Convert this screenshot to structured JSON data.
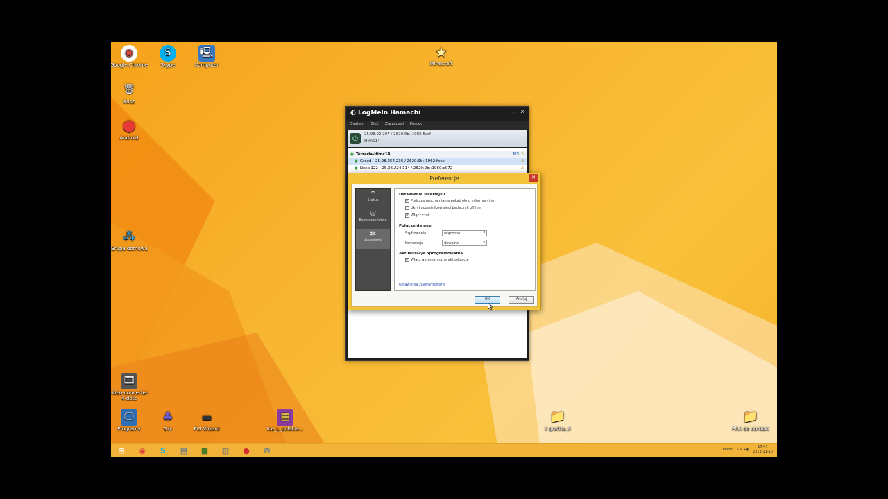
{
  "desktop": {
    "icons": [
      {
        "label": "Google Chrome",
        "glyph": "◉",
        "color": "#db4437"
      },
      {
        "label": "Skype",
        "glyph": "S",
        "color": "#00aff0"
      },
      {
        "label": "Komputer",
        "glyph": "🖳",
        "color": "#3a78c2"
      },
      {
        "label": "Minecraft",
        "glyph": "★",
        "color": "#f6e06a"
      },
      {
        "label": "Kosz",
        "glyph": "🗑",
        "color": "#aaa"
      },
      {
        "label": "Android",
        "glyph": "●",
        "color": "#e53935"
      },
      {
        "label": "Grupa domowa",
        "glyph": "⁂",
        "color": "#3aa0e0"
      },
      {
        "label": "video-converter-4-dots",
        "glyph": "🎞",
        "color": "#555"
      },
      {
        "label": "Programy",
        "glyph": "🖵",
        "color": "#2f6fb8"
      },
      {
        "label": "Gry",
        "glyph": "♣",
        "color": "#6a5acd"
      },
      {
        "label": "PCI Wizard",
        "glyph": "▬",
        "color": "#444"
      },
      {
        "label": "Ice_L_polskie...",
        "glyph": "▦",
        "color": "#8b3aa0"
      },
      {
        "label": "ll grafika_ll",
        "glyph": "📁",
        "color": "#e3c36a"
      },
      {
        "label": "Pliki do obróbki",
        "glyph": "📁",
        "color": "#e3c36a"
      }
    ]
  },
  "hamachi": {
    "title": "LogMeIn Hamachi",
    "menu": [
      "System",
      "Sieć",
      "Zarządzaj",
      "Pomoc"
    ],
    "address": "25.98.92.207 / 2620:9b::1982:5ccf",
    "client_name": "Himc14",
    "network": {
      "name": "Terraria-Himc14",
      "count": "3/3"
    },
    "peers": [
      "Greed - 25.98.254.236 / 2620:9b::1962:feec",
      "Nexio122 - 25.96.224.114 / 2620:9b::1960:e072"
    ]
  },
  "preferences": {
    "title": "Preferencje",
    "sidebar": [
      "Status",
      "Bezpieczeństwo",
      "Ustawienia"
    ],
    "interface_header": "Ustawienia interfejsu",
    "checkboxes": [
      {
        "label": "Podczas uruchamiania pokaż okno informacyjne",
        "checked": "✔"
      },
      {
        "label": "Ukryj uczestników sieci będących offline",
        "checked": ""
      },
      {
        "label": "Włącz czat",
        "checked": "✔"
      }
    ],
    "peer_header": "Połączenia peer",
    "encryption_label": "Szyfrowanie",
    "encryption_value": "włączono",
    "compression_label": "Kompresja",
    "compression_value": "dowolne",
    "updates_header": "Aktualizacje oprogramowania",
    "auto_update": {
      "label": "Włącz automatyczne aktualizacje",
      "checked": "✔"
    },
    "advanced_link": "Ustawienia zaawansowane",
    "ok_label": "OK",
    "cancel_label": "Anuluj"
  },
  "taskbar": {
    "start_glyph": "⊞",
    "pinned": [
      "◉",
      "S",
      "▤",
      "■",
      "▥",
      "●",
      "✇"
    ],
    "desktop_label": "Pulpit",
    "time": "17:47",
    "date": "2013-11-10"
  }
}
